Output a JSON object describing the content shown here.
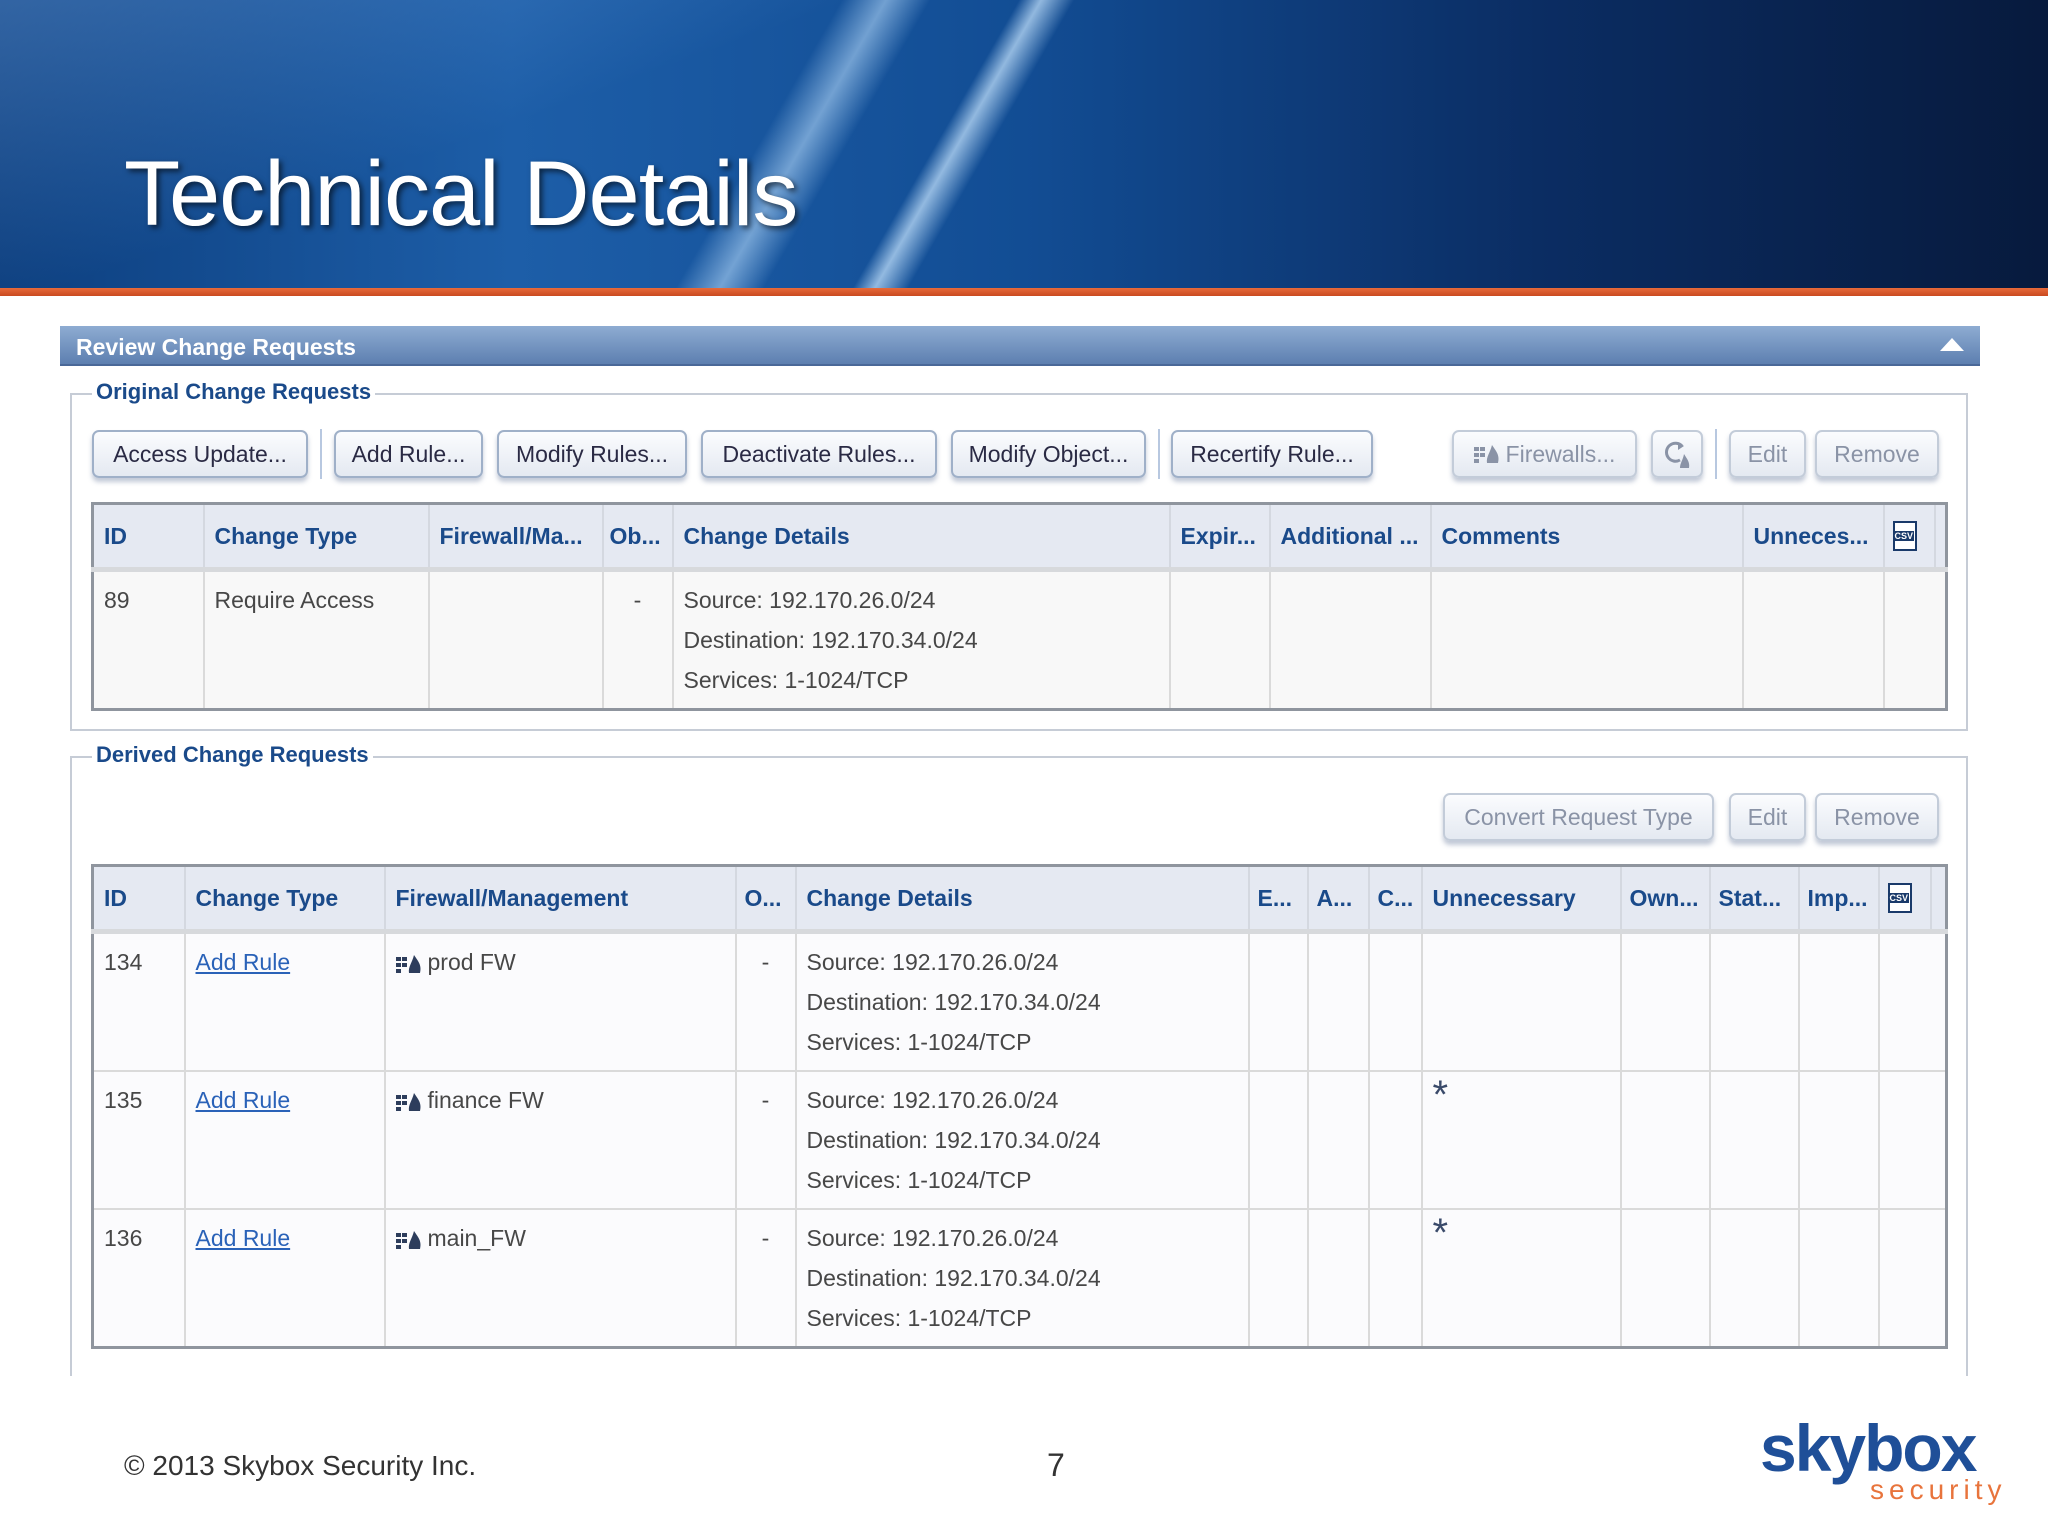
{
  "slide": {
    "title": "Technical Details",
    "footer": "© 2013 Skybox Security Inc.",
    "page": "7",
    "logo_main": "skybox",
    "logo_sub": "security"
  },
  "panel": {
    "title": "Review Change Requests"
  },
  "original": {
    "legend": "Original Change Requests",
    "buttons": [
      "Access Update...",
      "Add Rule...",
      "Modify Rules...",
      "Deactivate Rules...",
      "Modify Object...",
      "Recertify Rule...",
      "Firewalls...",
      "Edit",
      "Remove"
    ],
    "columns": [
      "ID",
      "Change Type",
      "Firewall/Ma...",
      "Ob...",
      "Change Details",
      "Expir...",
      "Additional ...",
      "Comments",
      "Unneces..."
    ],
    "rows": [
      {
        "id": "89",
        "type": "Require Access",
        "fw": "",
        "ob": "-",
        "details": [
          "Source: 192.170.26.0/24",
          "Destination: 192.170.34.0/24",
          "Services: 1-1024/TCP"
        ]
      }
    ]
  },
  "derived": {
    "legend": "Derived Change Requests",
    "buttons": [
      "Convert Request Type",
      "Edit",
      "Remove"
    ],
    "columns": [
      "ID",
      "Change Type",
      "Firewall/Management",
      "O...",
      "Change Details",
      "E...",
      "A...",
      "C...",
      "Unnecessary",
      "Own...",
      "Stat...",
      "Imp..."
    ],
    "rows": [
      {
        "id": "134",
        "type": "Add Rule",
        "fw": "prod FW",
        "o": "-",
        "details": [
          "Source: 192.170.26.0/24",
          "Destination: 192.170.34.0/24",
          "Services: 1-1024/TCP"
        ],
        "unnecessary": ""
      },
      {
        "id": "135",
        "type": "Add Rule",
        "fw": "finance FW",
        "o": "-",
        "details": [
          "Source: 192.170.26.0/24",
          "Destination: 192.170.34.0/24",
          "Services: 1-1024/TCP"
        ],
        "unnecessary": "*"
      },
      {
        "id": "136",
        "type": "Add Rule",
        "fw": "main_FW",
        "o": "-",
        "details": [
          "Source: 192.170.26.0/24",
          "Destination: 192.170.34.0/24",
          "Services: 1-1024/TCP"
        ],
        "unnecessary": "*"
      }
    ]
  }
}
